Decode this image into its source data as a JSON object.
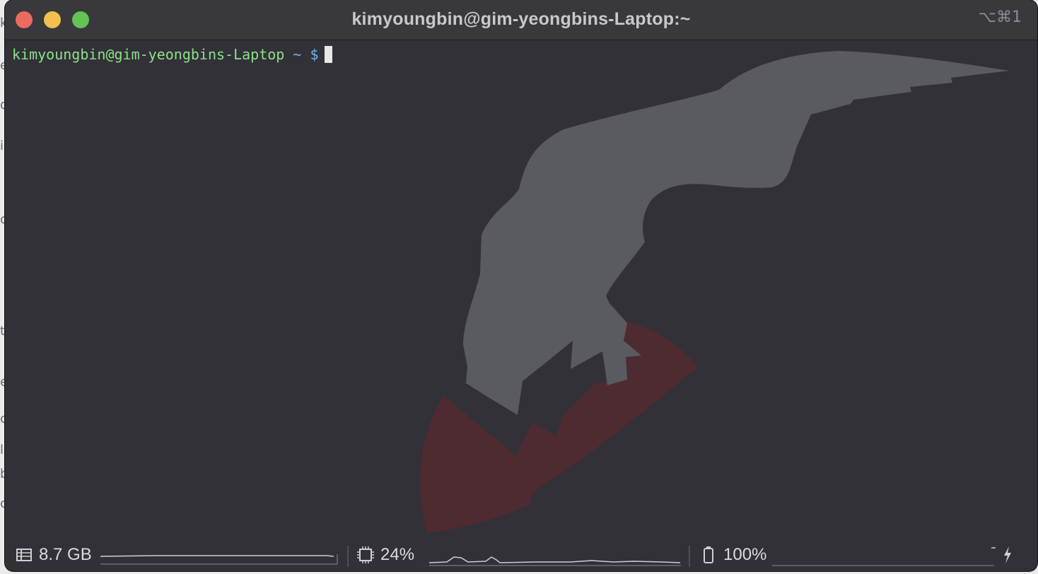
{
  "window": {
    "title": "kimyoungbin@gim-yeongbins-Laptop:~",
    "shortcut": "⌥⌘1"
  },
  "backdrop": {
    "edge_glyphs": [
      "k",
      "e",
      "d",
      "i",
      "c",
      "t",
      "e",
      "c",
      "l",
      "b",
      "c"
    ]
  },
  "terminal": {
    "prompt_user_host": "kimyoungbin@gim-yeongbins-Laptop",
    "prompt_path": "~",
    "prompt_symbol": "$"
  },
  "status": {
    "memory": {
      "icon": "memory-icon",
      "value": "8.7 GB"
    },
    "cpu": {
      "icon": "cpu-icon",
      "value": "24%"
    },
    "battery": {
      "icon": "battery-icon",
      "value": "100%",
      "charging_icon": "lightning-icon"
    }
  },
  "colors": {
    "terminal_bg": "#313137",
    "titlebar_bg": "#38383d",
    "prompt_user": "#8ee08a",
    "prompt_path": "#6db4f0",
    "art_grey": "#5a5b60",
    "art_red": "#4e2b31"
  }
}
